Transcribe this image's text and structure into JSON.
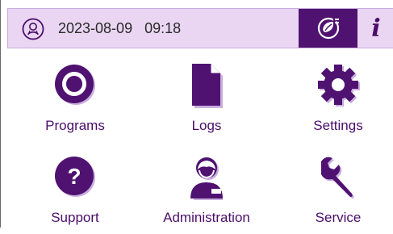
{
  "header": {
    "datetime": "2023-08-09   09:18",
    "user_icon": "user-badge-icon",
    "eco_icon": "plug-leaf-icon",
    "info_label": "i"
  },
  "menu": {
    "programs": "Programs",
    "logs": "Logs",
    "settings": "Settings",
    "support": "Support",
    "administration": "Administration",
    "service": "Service"
  },
  "colors": {
    "accent": "#4f1271",
    "topbar_bg": "#ead6f2",
    "icon_shadow": "#c9aede"
  }
}
